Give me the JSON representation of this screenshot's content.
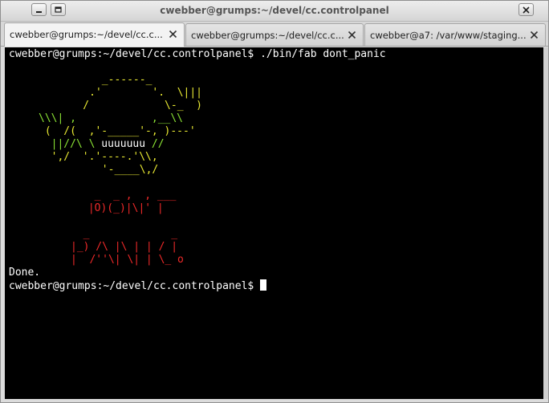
{
  "window": {
    "title": "cwebber@grumps:~/devel/cc.controlpanel"
  },
  "tabs": [
    {
      "label": "cwebber@grumps:~/devel/cc.c...",
      "active": true
    },
    {
      "label": "cwebber@grumps:~/devel/cc.c...",
      "active": false
    },
    {
      "label": "cwebber@a7: /var/www/staging...",
      "active": false
    }
  ],
  "terminal": {
    "prompt": "cwebber@grumps:~/devel/cc.controlpanel$",
    "command": "./bin/fab dont_panic",
    "output_done": "Done.",
    "prompt2": "cwebber@grumps:~/devel/cc.controlpanel$",
    "art": {
      "face": {
        "line1": "       _------_",
        "line2": "     .'        '.  \\|||",
        "line3": "    /            \\-_  )",
        "line4": "\\\\\\| ,            ,__\\\\",
        "line5": " (  /(  ,'-_____'-, )---'",
        "line6": "  ||//\\ \\ ",
        "line6_teeth": "uuuuuuu",
        "line6_end": " //",
        "line7": "  ',/  '.'----.'\\\\,",
        "line8": "       '-____\\,/"
      },
      "banner": {
        "line1": "  _  _ ,  , ___",
        "line2": " |O)(_)|\\|' |",
        "line3": "",
        "line4": "  _             _",
        "line5": "|_) /\\ |\\ | | / |",
        "line6": "|  /''\\| \\| | \\_ o"
      }
    }
  },
  "colors": {
    "terminal_bg": "#000000",
    "terminal_fg": "#ffffff",
    "art_green": "#8ae234",
    "art_yellow": "#e8e832",
    "art_red": "#ef2929"
  }
}
